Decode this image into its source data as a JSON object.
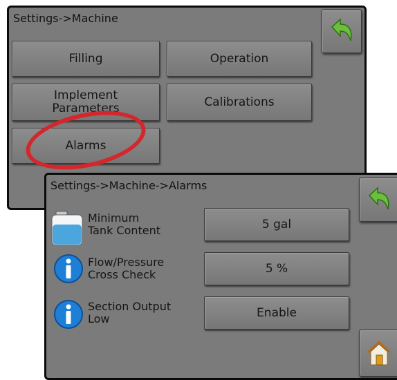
{
  "machine_screen": {
    "breadcrumb": "Settings->Machine",
    "buttons": {
      "filling": "Filling",
      "operation": "Operation",
      "implement_line1": "Implement",
      "implement_line2": "Parameters",
      "calibrations": "Calibrations",
      "alarms": "Alarms"
    },
    "back_icon": "back-arrow-icon"
  },
  "alarms_screen": {
    "breadcrumb": "Settings->Machine->Alarms",
    "rows": [
      {
        "label_line1": "Minimum",
        "label_line2": "Tank Content",
        "value": "5 gal",
        "icon": "tank-icon"
      },
      {
        "label_line1": "Flow/Pressure",
        "label_line2": "Cross Check",
        "value": "5 %",
        "icon": "info-icon"
      },
      {
        "label_line1": "Section Output",
        "label_line2": "Low",
        "value": "Enable",
        "icon": "info-icon"
      }
    ],
    "back_icon": "back-arrow-icon",
    "home_icon": "home-icon"
  },
  "colors": {
    "screen_bg": "#7b7b7b",
    "highlight": "#d3272c",
    "back_arrow": "#6cbf3a",
    "info_blue": "#1f7fd6"
  }
}
